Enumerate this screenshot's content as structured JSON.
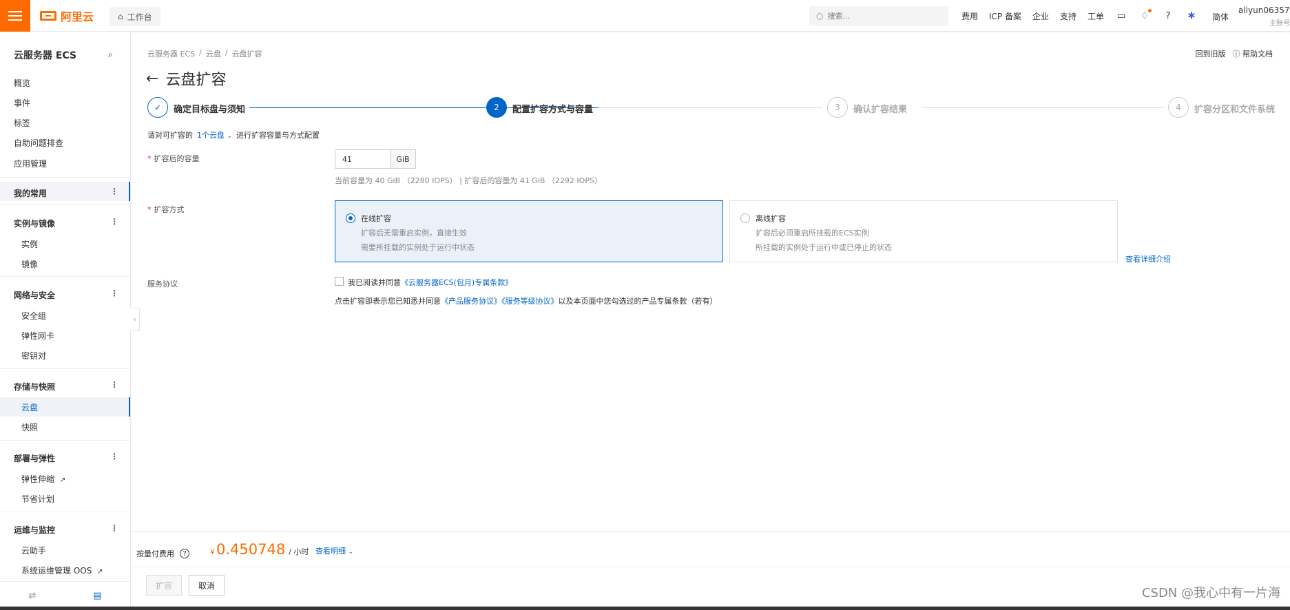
{
  "topbar": {
    "brand": "阿里云",
    "workspace_label": "工作台",
    "search_placeholder": "搜索...",
    "nav_links": [
      "费用",
      "ICP 备案",
      "企业",
      "支持",
      "工单"
    ],
    "language": "简体",
    "account_name": "aliyun06357...",
    "account_sub": "主账号"
  },
  "sidebar": {
    "title": "云服务器 ECS",
    "top_items": [
      "概览",
      "事件",
      "标签",
      "自助问题排查",
      "应用管理"
    ],
    "favorites": "我的常用",
    "groups": [
      {
        "title": "实例与镜像",
        "items": [
          "实例",
          "镜像"
        ]
      },
      {
        "title": "网络与安全",
        "items": [
          "安全组",
          "弹性网卡",
          "密钥对"
        ]
      },
      {
        "title": "存储与快照",
        "items": [
          "云盘",
          "快照"
        ]
      },
      {
        "title": "部署与弹性",
        "items": [
          "弹性伸缩",
          "节省计划"
        ]
      },
      {
        "title": "运维与监控",
        "items": [
          "云助手",
          "系统运维管理 OOS"
        ]
      }
    ],
    "active_item": "云盘"
  },
  "breadcrumb": [
    "云服务器 ECS",
    "云盘",
    "云盘扩容"
  ],
  "breadcrumb_sep": "/",
  "top_links": {
    "old_version": "回到旧版",
    "help_docs": "帮助文档"
  },
  "page_title": "云盘扩容",
  "steps": [
    {
      "num": "✓",
      "label": "确定目标盘与须知",
      "state": "done"
    },
    {
      "num": "2",
      "label": "配置扩容方式与容量",
      "state": "current"
    },
    {
      "num": "3",
      "label": "确认扩容结果",
      "state": "todo"
    },
    {
      "num": "4",
      "label": "扩容分区和文件系统",
      "state": "todo"
    }
  ],
  "config": {
    "prefix": "请对可扩容的",
    "disk_link": "1个云盘",
    "suffix": "进行扩容容量与方式配置"
  },
  "capacity": {
    "label": "扩容后的容量",
    "value": "41",
    "unit": "GiB",
    "hint": "当前容量为 40 GiB （2280 IOPS） | 扩容后的容量为 41 GiB （2292 IOPS）"
  },
  "method": {
    "label": "扩容方式",
    "options": [
      {
        "title": "在线扩容",
        "desc1": "扩容后无需重启实例，直接生效",
        "desc2": "需要所挂载的实例处于运行中状态",
        "selected": true
      },
      {
        "title": "离线扩容",
        "desc1": "扩容后必须重启所挂载的ECS实例",
        "desc2": "所挂载的实例处于运行中或已停止的状态",
        "selected": false
      }
    ],
    "details_link": "查看详细介绍"
  },
  "agreement": {
    "label": "服务协议",
    "checkbox_text": "我已阅读并同意",
    "checkbox_link": "《云服务器ECS(包月)专属条款》",
    "note_prefix": "点击扩容即表示您已知悉并同意",
    "note_link1": "《产品服务协议》",
    "note_link2": "《服务等级协议》",
    "note_suffix": "以及本页面中您勾选过的产品专属条款（若有）"
  },
  "footer": {
    "fee_label": "按量付费用",
    "currency": "¥",
    "price": "0.450748",
    "price_unit": "/ 小时",
    "view_detail": "查看明细",
    "confirm_button": "扩容",
    "cancel_button": "取消",
    "watermark": "CSDN @我心中有一片海"
  }
}
